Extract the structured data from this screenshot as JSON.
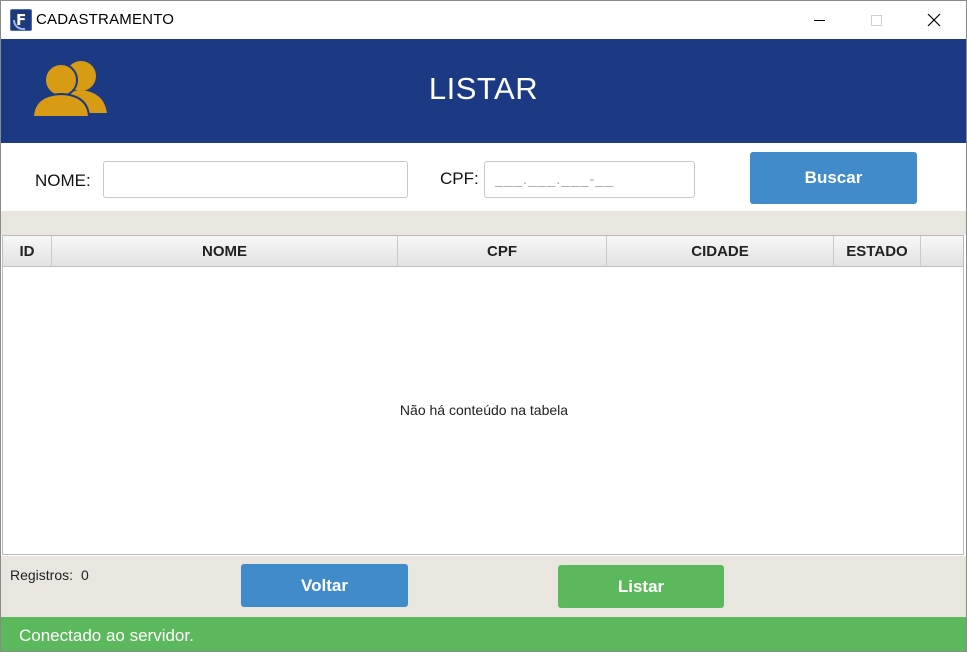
{
  "window": {
    "title": "CADASTRAMENTO",
    "icon": "app-f-icon",
    "controls": [
      "minimize-icon",
      "maximize-icon",
      "close-icon"
    ]
  },
  "header": {
    "icon": "users-icon",
    "title": "LISTAR",
    "background": "#1c3983",
    "icon_color": "#d79b14"
  },
  "search": {
    "nome_label": "NOME:",
    "nome_value": "",
    "cpf_label": "CPF:",
    "cpf_placeholder": "___.___.___-__",
    "buscar_label": "Buscar"
  },
  "table": {
    "columns": [
      "ID",
      "NOME",
      "CPF",
      "CIDADE",
      "ESTADO"
    ],
    "rows": [],
    "empty_message": "Não há conteúdo na tabela"
  },
  "footer": {
    "registros_label": "Registros:",
    "registros_count": "0",
    "voltar_label": "Voltar",
    "listar_label": "Listar"
  },
  "status": {
    "text": "Conectado ao servidor.",
    "color": "#5cb85c"
  },
  "colors": {
    "primary_button": "#428bca",
    "success_button": "#5cb85c"
  }
}
